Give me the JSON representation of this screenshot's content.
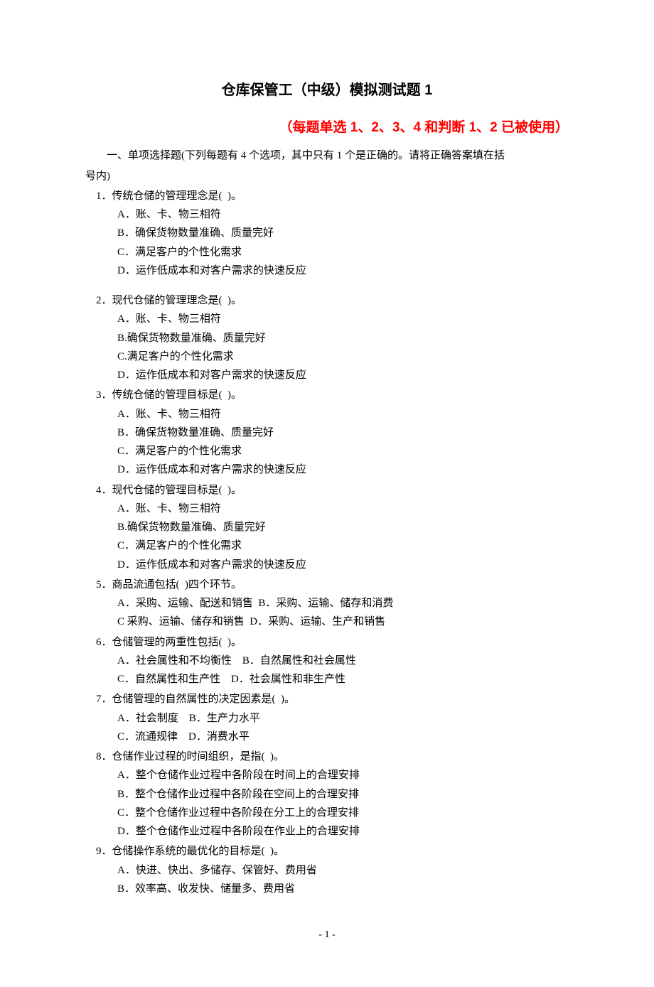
{
  "title": "仓库保管工（中级）模拟测试题 1",
  "subtitle": "（每题单选 1、2、3、4 和判断 1、2 已被使用）",
  "instructions_line1": "一、单项选择题(下列每题有 4 个选项，其中只有 1 个是正确的。请将正确答案填在括",
  "instructions_line2": "号内)",
  "q1": {
    "stem": "1．传统仓储的管理理念是(  )。",
    "a": "A．账、卡、物三相符",
    "b": "B．确保货物数量准确、质量完好",
    "c": "C．满足客户的个性化需求",
    "d": "D．运作低成本和对客户需求的快速反应"
  },
  "q2": {
    "stem": "2．现代仓储的管理理念是(  )。",
    "a": "A．账、卡、物三相符",
    "b": "B.确保货物数量准确、质量完好",
    "c": "C.满足客户的个性化需求",
    "d": "D．运作低成本和对客户需求的快速反应"
  },
  "q3": {
    "stem": "3．传统仓储的管理目标是(  )。",
    "a": "A．账、卡、物三相符",
    "b": "B．确保货物数量准确、质量完好",
    "c": "C．满足客户的个性化需求",
    "d": "D．运作低成本和对客户需求的快速反应"
  },
  "q4": {
    "stem": "4．现代仓储的管理目标是(  )。",
    "a": "A．账、卡、物三相符",
    "b": "B.确保货物数量准确、质量完好",
    "c": "C．满足客户的个性化需求",
    "d": "D．运作低成本和对客户需求的快速反应"
  },
  "q5": {
    "stem": "5．商品流通包括(  )四个环节。",
    "line1": "A．采购、运输、配送和销售  B．采购、运输、储存和消费",
    "line2": "C 采购、运输、储存和销售  D．采购、运输、生产和销售"
  },
  "q6": {
    "stem": "6．仓储管理的两重性包括(  )。",
    "line1": "A．社会属性和不均衡性    B．自然属性和社会属性",
    "line2": "C．自然属性和生产性    D．社会属性和非生产性"
  },
  "q7": {
    "stem": "7．仓储管理的自然属性的决定因素是(  )。",
    "line1": "A．社会制度    B．生产力水平",
    "line2": "C．流通规律    D．消费水平"
  },
  "q8": {
    "stem": "8．仓储作业过程的时间组织，是指(  )。",
    "a": "A．整个仓储作业过程中各阶段在时间上的合理安排",
    "b": "B．整个仓储作业过程中各阶段在空间上的合理安排",
    "c": "C．整个仓储作业过程中各阶段在分工上的合理安排",
    "d": "D．整个仓储作业过程中各阶段在作业上的合理安排"
  },
  "q9": {
    "stem": "9．仓储操作系统的最优化的目标是(  )。",
    "a": "A．快进、快出、多储存、保管好、费用省",
    "b": "B．效率高、收发快、储量多、费用省"
  },
  "page_number": "- 1 -"
}
